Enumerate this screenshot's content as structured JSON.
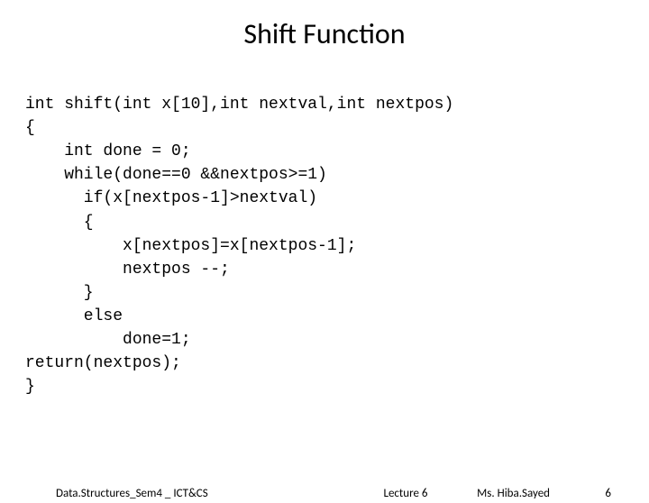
{
  "title": "Shift Function",
  "code": {
    "l1": "int shift(int x[10],int nextval,int nextpos)",
    "l2": "{",
    "l3": "    int done = 0;",
    "l4": "    while(done==0 &&nextpos>=1)",
    "l5": "      if(x[nextpos-1]>nextval)",
    "l6": "      {",
    "l7": "          x[nextpos]=x[nextpos-1];",
    "l8": "          nextpos --;",
    "l9": "      }",
    "l10": "      else",
    "l11": "          done=1;",
    "l12": "return(nextpos);",
    "l13": "}"
  },
  "footer": {
    "left": "Data.Structures_Sem4 _ ICT&CS",
    "center": "Lecture 6",
    "right1": "Ms. Hiba.Sayed",
    "right2": "6"
  }
}
